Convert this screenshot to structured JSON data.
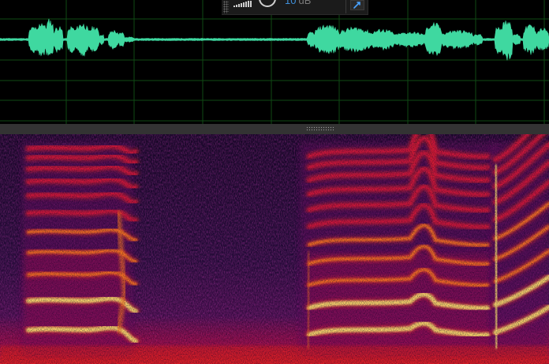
{
  "hud": {
    "gain_value": "10",
    "gain_unit": "dB",
    "grip_icon": "drag-grip-icon",
    "meter_icon": "level-meter-icon",
    "knob_icon": "volume-knob-icon",
    "pin_icon": "pin-icon"
  },
  "colors": {
    "waveform": "#3fd8a0",
    "grid": "#0f4a14",
    "background": "#000000",
    "hud_value": "#3f8fd9",
    "divider": "#333333",
    "spectrogram_low": "#1e0a2a",
    "spectrogram_mid": "#c0104a",
    "spectrogram_high": "#ffe070"
  }
}
